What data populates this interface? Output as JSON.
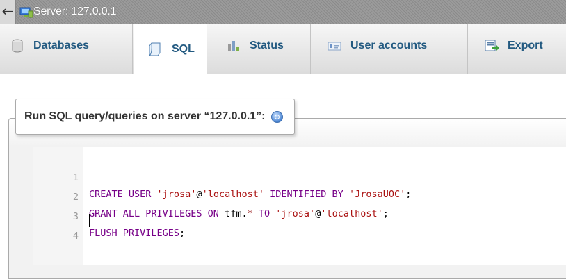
{
  "header": {
    "server_label": "Server: 127.0.0.1"
  },
  "tabs": [
    {
      "label": "Databases",
      "icon": "database-icon",
      "active": false
    },
    {
      "label": "SQL",
      "icon": "sql-icon",
      "active": true
    },
    {
      "label": "Status",
      "icon": "status-icon",
      "active": false
    },
    {
      "label": "User accounts",
      "icon": "user-accounts-icon",
      "active": false
    },
    {
      "label": "Export",
      "icon": "export-icon",
      "active": false
    }
  ],
  "panel": {
    "legend": "Run SQL query/queries on server “127.0.0.1”:"
  },
  "editor": {
    "lines": [
      {
        "number": "1",
        "text": "CREATE USER 'jrosa'@'localhost' IDENTIFIED BY 'JrosaUOC';"
      },
      {
        "number": "2",
        "text": "GRANT ALL PRIVILEGES ON tfm.* TO 'jrosa'@'localhost';"
      },
      {
        "number": "3",
        "text": "FLUSH PRIVILEGES;"
      },
      {
        "number": "4",
        "text": ""
      }
    ]
  },
  "colors": {
    "tab_text": "#235a81",
    "keyword": "#770088",
    "string": "#aa1111"
  }
}
